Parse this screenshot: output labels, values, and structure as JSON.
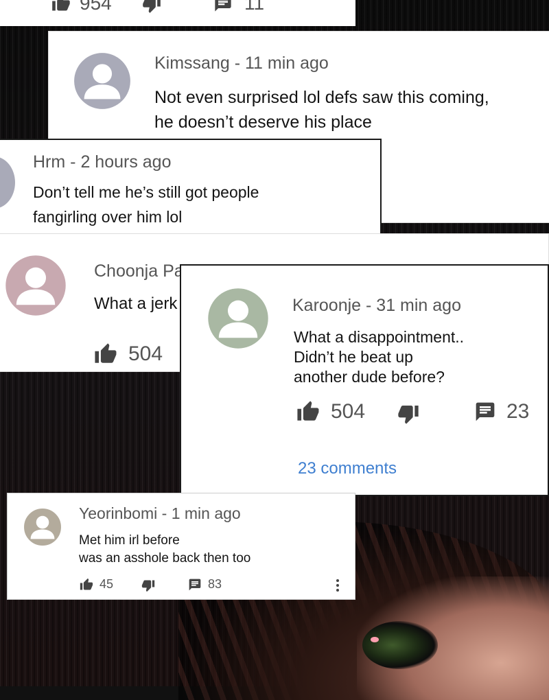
{
  "top_partial": {
    "likes": "954",
    "replies": "11"
  },
  "comments": [
    {
      "id": "kimssang",
      "author": "Kimssang",
      "time": "11 min ago",
      "text": "Not even surprised lol defs saw this coming,\nhe doesn’t deserve his place",
      "avatar_color": "#a9aab8"
    },
    {
      "id": "hrm",
      "author": "Hrm",
      "time": "2 hours ago",
      "text": "Don’t tell me he’s still got people\nfangirling over him lol",
      "avatar_color": "#a9aab8"
    },
    {
      "id": "choonja",
      "author": "Choonja Pa",
      "text": "What a jerk",
      "likes": "504",
      "avatar_color": "#c8a9b0"
    },
    {
      "id": "karoonje",
      "author": "Karoonje",
      "time": "31 min ago",
      "text": "What a disappointment..\nDidn’t he beat up\nanother dude before?",
      "likes": "504",
      "replies": "23",
      "view_comments": "23 comments",
      "avatar_color": "#a9b8a3"
    },
    {
      "id": "yeorinbomi",
      "author": "Yeorinbomi",
      "time": "1 min ago",
      "text": "Met him irl before\nwas an asshole back then too",
      "likes": "45",
      "replies": "83",
      "avatar_color": "#b3ab9c"
    }
  ],
  "colors": {
    "link": "#3f7fd0",
    "muted": "#555555"
  }
}
